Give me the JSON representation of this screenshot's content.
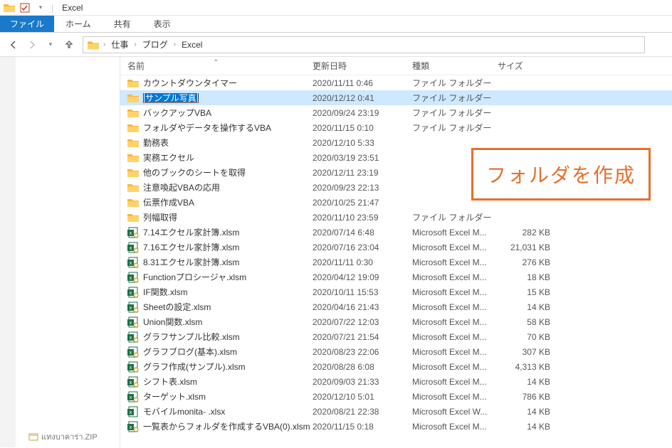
{
  "titlebar": {
    "title": "Excel"
  },
  "ribbon": {
    "file": "ファイル",
    "tabs": [
      "ホーム",
      "共有",
      "表示"
    ]
  },
  "breadcrumb": {
    "items": [
      "仕事",
      "ブログ",
      "Excel"
    ]
  },
  "columns": {
    "name": "名前",
    "date": "更新日時",
    "type": "種類",
    "size": "サイズ"
  },
  "rename_value": "サンプル写真",
  "callout_text": "フォルダを作成",
  "sidebar_bottom": "แทงบาคาร่า.zip",
  "rows": [
    {
      "icon": "folder",
      "name": "カウントダウンタイマー",
      "date": "2020/11/11 0:46",
      "type": "ファイル フォルダー",
      "size": ""
    },
    {
      "icon": "folder",
      "name": "",
      "date": "2020/12/12 0:41",
      "type": "ファイル フォルダー",
      "size": "",
      "editing": true
    },
    {
      "icon": "folder",
      "name": "バックアップVBA",
      "date": "2020/09/24 23:19",
      "type": "ファイル フォルダー",
      "size": ""
    },
    {
      "icon": "folder",
      "name": "フォルダやデータを操作するVBA",
      "date": "2020/11/15 0:10",
      "type": "ファイル フォルダー",
      "size": ""
    },
    {
      "icon": "folder",
      "name": "勤務表",
      "date": "2020/12/10 5:33",
      "type": "",
      "size": ""
    },
    {
      "icon": "folder",
      "name": "実務エクセル",
      "date": "2020/03/19 23:51",
      "type": "",
      "size": ""
    },
    {
      "icon": "folder",
      "name": "他のブックのシートを取得",
      "date": "2020/12/11 23:19",
      "type": "",
      "size": ""
    },
    {
      "icon": "folder",
      "name": "注意喚起VBAの応用",
      "date": "2020/09/23 22:13",
      "type": "",
      "size": ""
    },
    {
      "icon": "folder",
      "name": "伝票作成VBA",
      "date": "2020/10/25 21:47",
      "type": "",
      "size": ""
    },
    {
      "icon": "folder",
      "name": "列幅取得",
      "date": "2020/11/10 23:59",
      "type": "ファイル フォルダー",
      "size": ""
    },
    {
      "icon": "xlsm",
      "name": "7.14エクセル家計簿.xlsm",
      "date": "2020/07/14 6:48",
      "type": "Microsoft Excel M...",
      "size": "282 KB"
    },
    {
      "icon": "xlsm",
      "name": "7.16エクセル家計簿.xlsm",
      "date": "2020/07/16 23:04",
      "type": "Microsoft Excel M...",
      "size": "21,031 KB"
    },
    {
      "icon": "xlsm",
      "name": "8.31エクセル家計簿.xlsm",
      "date": "2020/11/11 0:30",
      "type": "Microsoft Excel M...",
      "size": "276 KB"
    },
    {
      "icon": "xlsm",
      "name": "Functionプロシージャ.xlsm",
      "date": "2020/04/12 19:09",
      "type": "Microsoft Excel M...",
      "size": "18 KB"
    },
    {
      "icon": "xlsm",
      "name": "IF関数.xlsm",
      "date": "2020/10/11 15:53",
      "type": "Microsoft Excel M...",
      "size": "15 KB"
    },
    {
      "icon": "xlsm",
      "name": "Sheetの設定.xlsm",
      "date": "2020/04/16 21:43",
      "type": "Microsoft Excel M...",
      "size": "14 KB"
    },
    {
      "icon": "xlsm",
      "name": "Union関数.xlsm",
      "date": "2020/07/22 12:03",
      "type": "Microsoft Excel M...",
      "size": "58 KB"
    },
    {
      "icon": "xlsm",
      "name": "グラフサンプル比較.xlsm",
      "date": "2020/07/21 21:54",
      "type": "Microsoft Excel M...",
      "size": "70 KB"
    },
    {
      "icon": "xlsm",
      "name": "グラフブログ(基本).xlsm",
      "date": "2020/08/23 22:06",
      "type": "Microsoft Excel M...",
      "size": "307 KB"
    },
    {
      "icon": "xlsm",
      "name": "グラフ作成(サンプル).xlsm",
      "date": "2020/08/28 6:08",
      "type": "Microsoft Excel M...",
      "size": "4,313 KB"
    },
    {
      "icon": "xlsm",
      "name": "シフト表.xlsm",
      "date": "2020/09/03 21:33",
      "type": "Microsoft Excel M...",
      "size": "14 KB"
    },
    {
      "icon": "xlsm",
      "name": "ターゲット.xlsm",
      "date": "2020/12/10 5:01",
      "type": "Microsoft Excel M...",
      "size": "786 KB"
    },
    {
      "icon": "xlsx",
      "name": "モバイルmonita- .xlsx",
      "date": "2020/08/21 22:38",
      "type": "Microsoft Excel W...",
      "size": "14 KB"
    },
    {
      "icon": "xlsm",
      "name": "一覧表からフォルダを作成するVBA(0).xlsm",
      "date": "2020/11/15 0:18",
      "type": "Microsoft Excel M...",
      "size": "14 KB"
    }
  ]
}
